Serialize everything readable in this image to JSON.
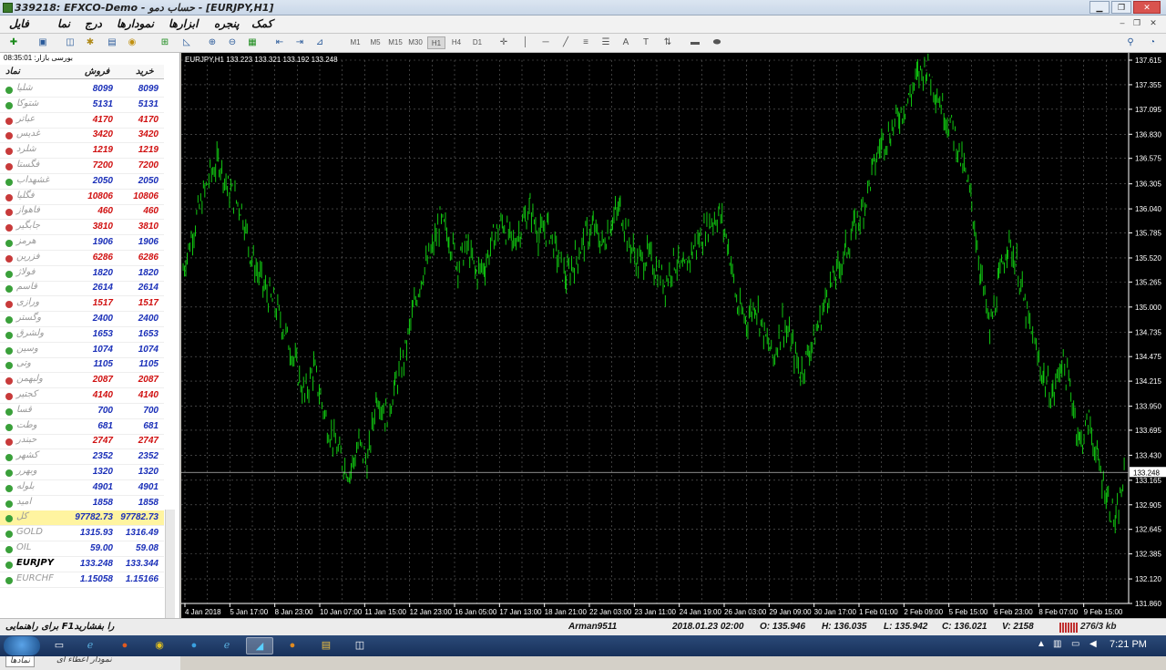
{
  "window": {
    "title": "339218: EFXCO-Demo - حساب دمو - [EURJPY,H1]",
    "controls": {
      "minimize": "▁",
      "maximize": "❐",
      "close": "✕"
    }
  },
  "menu": {
    "items": [
      "فایل",
      "نما",
      "درج",
      "نمودارها",
      "ابزارها",
      "پنجره",
      "کمک"
    ],
    "mdi_controls": {
      "minimize": "‒",
      "restore": "❐",
      "close": "✕"
    }
  },
  "toolbar": {
    "timeframes": [
      "M1",
      "M5",
      "M15",
      "M30",
      "H1",
      "H4",
      "D1"
    ],
    "active_timeframe": "H1",
    "tools": [
      "new-chart-icon",
      "profiles-icon",
      "market-watch-icon",
      "navigator-icon",
      "terminal-icon",
      "strategy-tester-icon",
      "new-order-icon",
      "autotrading-icon",
      "zoom-in-icon",
      "zoom-out-icon",
      "tile-windows-icon",
      "chart-shift-icon",
      "autoscroll-icon",
      "indicators-icon",
      "crosshair-icon",
      "vertical-line-icon",
      "horizontal-line-icon",
      "trendline-icon",
      "channel-icon",
      "fibonacci-icon",
      "text-icon",
      "text-label-icon",
      "arrows-icon",
      "periods-icon",
      "templates-icon"
    ]
  },
  "market_watch": {
    "header": "بورسی بازار: 08:35:01",
    "columns": {
      "symbol": "نماد",
      "bid": "فروش",
      "ask": "خرید"
    },
    "rows": [
      {
        "symbol": "شلیا",
        "bid": "8099",
        "ask": "8099",
        "dir": "up"
      },
      {
        "symbol": "شتوکا",
        "bid": "5131",
        "ask": "5131",
        "dir": "up"
      },
      {
        "symbol": "عباتر",
        "bid": "4170",
        "ask": "4170",
        "dir": "dn"
      },
      {
        "symbol": "غدیس",
        "bid": "3420",
        "ask": "3420",
        "dir": "dn"
      },
      {
        "symbol": "شلرد",
        "bid": "1219",
        "ask": "1219",
        "dir": "dn"
      },
      {
        "symbol": "فگستا",
        "bid": "7200",
        "ask": "7200",
        "dir": "dn"
      },
      {
        "symbol": "غشهداب",
        "bid": "2050",
        "ask": "2050",
        "dir": "up"
      },
      {
        "symbol": "فگلیا",
        "bid": "10806",
        "ask": "10806",
        "dir": "dn"
      },
      {
        "symbol": "فاهواز",
        "bid": "460",
        "ask": "460",
        "dir": "dn"
      },
      {
        "symbol": "جابگیر",
        "bid": "3810",
        "ask": "3810",
        "dir": "dn"
      },
      {
        "symbol": "هرمز",
        "bid": "1906",
        "ask": "1906",
        "dir": "up"
      },
      {
        "symbol": "فزرین",
        "bid": "6286",
        "ask": "6286",
        "dir": "dn"
      },
      {
        "symbol": "فولاژ",
        "bid": "1820",
        "ask": "1820",
        "dir": "up"
      },
      {
        "symbol": "قاسم",
        "bid": "2614",
        "ask": "2614",
        "dir": "up"
      },
      {
        "symbol": "ورازی",
        "bid": "1517",
        "ask": "1517",
        "dir": "dn"
      },
      {
        "symbol": "وگستر",
        "bid": "2400",
        "ask": "2400",
        "dir": "up"
      },
      {
        "symbol": "ولشرق",
        "bid": "1653",
        "ask": "1653",
        "dir": "up"
      },
      {
        "symbol": "وسین",
        "bid": "1074",
        "ask": "1074",
        "dir": "up"
      },
      {
        "symbol": "وتی",
        "bid": "1105",
        "ask": "1105",
        "dir": "up"
      },
      {
        "symbol": "ولبهمن",
        "bid": "2087",
        "ask": "2087",
        "dir": "dn"
      },
      {
        "symbol": "کجتیر",
        "bid": "4140",
        "ask": "4140",
        "dir": "dn"
      },
      {
        "symbol": "قسا",
        "bid": "700",
        "ask": "700",
        "dir": "up"
      },
      {
        "symbol": "وطت",
        "bid": "681",
        "ask": "681",
        "dir": "up"
      },
      {
        "symbol": "حبندر",
        "bid": "2747",
        "ask": "2747",
        "dir": "dn"
      },
      {
        "symbol": "کشهر",
        "bid": "2352",
        "ask": "2352",
        "dir": "up"
      },
      {
        "symbol": "وبهرر",
        "bid": "1320",
        "ask": "1320",
        "dir": "up"
      },
      {
        "symbol": "بلوله",
        "bid": "4901",
        "ask": "4901",
        "dir": "up"
      },
      {
        "symbol": "امید",
        "bid": "1858",
        "ask": "1858",
        "dir": "up"
      },
      {
        "symbol": "کل",
        "bid": "97782.73",
        "ask": "97782.73",
        "dir": "up",
        "hl": true
      },
      {
        "symbol": "GOLD",
        "bid": "1315.93",
        "ask": "1316.49",
        "dir": "up"
      },
      {
        "symbol": "OIL",
        "bid": "59.00",
        "ask": "59.08",
        "dir": "up"
      },
      {
        "symbol": "EURJPY",
        "bid": "133.248",
        "ask": "133.344",
        "dir": "up",
        "fx": true
      },
      {
        "symbol": "EURCHF",
        "bid": "1.15058",
        "ask": "1.15166",
        "dir": "up"
      }
    ],
    "tabs": [
      "نمادها",
      "نمودار اعطاء ای"
    ]
  },
  "chart_data": {
    "type": "line",
    "header": "EURJPY,H1 133.223 133.321 133.192 133.248",
    "ylim": [
      131.86,
      137.615
    ],
    "y_ticks": [
      "137.615",
      "137.355",
      "137.095",
      "136.830",
      "136.575",
      "136.305",
      "136.040",
      "135.785",
      "135.520",
      "135.265",
      "135.000",
      "134.735",
      "134.475",
      "134.215",
      "133.950",
      "133.695",
      "133.430",
      "133.165",
      "132.905",
      "132.645",
      "132.385",
      "132.120",
      "131.860"
    ],
    "x_ticks": [
      "4 Jan 2018",
      "5 Jan 17:00",
      "8 Jan 23:00",
      "10 Jan 07:00",
      "11 Jan 15:00",
      "12 Jan 23:00",
      "16 Jan 05:00",
      "17 Jan 13:00",
      "18 Jan 21:00",
      "22 Jan 03:00",
      "23 Jan 11:00",
      "24 Jan 19:00",
      "26 Jan 03:00",
      "29 Jan 09:00",
      "30 Jan 17:00",
      "1 Feb 01:00",
      "2 Feb 09:00",
      "5 Feb 15:00",
      "6 Feb 23:00",
      "8 Feb 07:00",
      "9 Feb 15:00"
    ],
    "current_price": "133.248",
    "current_label": "133.165",
    "series": [
      {
        "color": "#11c811",
        "key_points": [
          [
            0,
            135.4
          ],
          [
            6,
            135.95
          ],
          [
            12,
            136.4
          ],
          [
            16,
            136.55
          ],
          [
            20,
            136.25
          ],
          [
            26,
            136.05
          ],
          [
            30,
            135.55
          ],
          [
            36,
            135.2
          ],
          [
            42,
            134.95
          ],
          [
            48,
            134.55
          ],
          [
            54,
            134.05
          ],
          [
            58,
            134.35
          ],
          [
            64,
            133.75
          ],
          [
            70,
            133.4
          ],
          [
            74,
            133.25
          ],
          [
            78,
            133.55
          ],
          [
            82,
            133.35
          ],
          [
            86,
            134.1
          ],
          [
            90,
            133.85
          ],
          [
            94,
            134.15
          ],
          [
            98,
            134.45
          ],
          [
            102,
            134.95
          ],
          [
            106,
            135.35
          ],
          [
            110,
            135.55
          ],
          [
            114,
            135.9
          ],
          [
            118,
            135.75
          ],
          [
            122,
            135.45
          ],
          [
            126,
            135.65
          ],
          [
            130,
            135.35
          ],
          [
            134,
            135.45
          ],
          [
            138,
            135.75
          ],
          [
            142,
            135.9
          ],
          [
            146,
            135.65
          ],
          [
            150,
            135.85
          ],
          [
            154,
            136.05
          ],
          [
            158,
            135.75
          ],
          [
            162,
            135.85
          ],
          [
            166,
            135.55
          ],
          [
            170,
            135.3
          ],
          [
            174,
            135.5
          ],
          [
            178,
            135.7
          ],
          [
            182,
            135.85
          ],
          [
            186,
            135.65
          ],
          [
            190,
            135.9
          ],
          [
            194,
            136.05
          ],
          [
            198,
            135.7
          ],
          [
            202,
            135.45
          ],
          [
            206,
            135.55
          ],
          [
            210,
            135.4
          ],
          [
            214,
            135.25
          ],
          [
            218,
            135.5
          ],
          [
            222,
            135.35
          ],
          [
            226,
            135.6
          ],
          [
            230,
            135.75
          ],
          [
            234,
            135.9
          ],
          [
            238,
            136.0
          ],
          [
            242,
            135.65
          ],
          [
            246,
            135.0
          ],
          [
            250,
            134.85
          ],
          [
            254,
            135.05
          ],
          [
            258,
            134.7
          ],
          [
            262,
            134.45
          ],
          [
            266,
            134.85
          ],
          [
            270,
            134.6
          ],
          [
            274,
            134.3
          ],
          [
            278,
            134.55
          ],
          [
            282,
            134.8
          ],
          [
            286,
            135.15
          ],
          [
            290,
            135.35
          ],
          [
            294,
            135.6
          ],
          [
            298,
            135.85
          ],
          [
            302,
            136.05
          ],
          [
            306,
            136.45
          ],
          [
            310,
            136.75
          ],
          [
            314,
            136.85
          ],
          [
            318,
            137.05
          ],
          [
            322,
            137.2
          ],
          [
            326,
            137.45
          ],
          [
            330,
            137.55
          ],
          [
            334,
            137.3
          ],
          [
            338,
            137.05
          ],
          [
            342,
            136.85
          ],
          [
            346,
            136.5
          ],
          [
            350,
            136.1
          ],
          [
            354,
            135.35
          ],
          [
            358,
            134.75
          ],
          [
            362,
            135.25
          ],
          [
            366,
            135.7
          ],
          [
            370,
            135.45
          ],
          [
            374,
            134.95
          ],
          [
            378,
            134.55
          ],
          [
            382,
            134.25
          ],
          [
            386,
            134.05
          ],
          [
            390,
            134.45
          ],
          [
            394,
            134.1
          ],
          [
            398,
            133.55
          ],
          [
            402,
            133.8
          ],
          [
            406,
            133.35
          ],
          [
            410,
            133.0
          ],
          [
            414,
            132.7
          ],
          [
            418,
            133.248
          ]
        ]
      }
    ]
  },
  "status_bar": {
    "help": "برای راهنمایی F1را بفشارید",
    "profile": "Arman9511",
    "datetime": "2018.01.23 02:00",
    "open": "O: 135.946",
    "high": "H: 136.035",
    "low": "L: 135.942",
    "close": "C: 136.021",
    "volume": "V: 2158",
    "traffic": "276/3 kb"
  },
  "taskbar": {
    "time": "7:21 PM",
    "apps": [
      "explorer",
      "chrome",
      "chrome2",
      "chrome3",
      "ie",
      "telegram",
      "firefox",
      "files",
      "metatrader"
    ]
  }
}
